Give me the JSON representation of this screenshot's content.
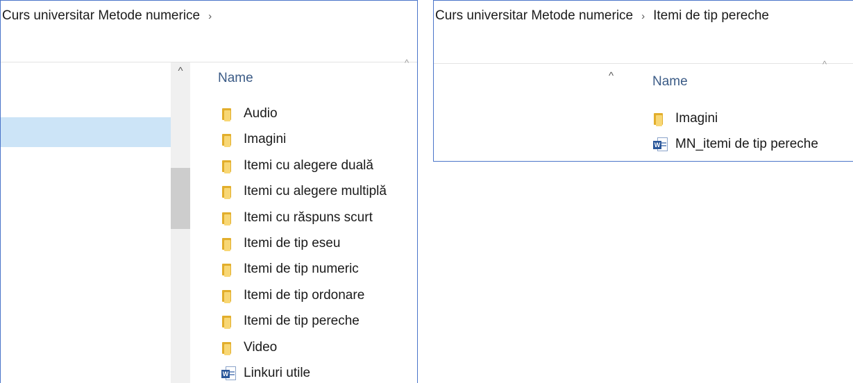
{
  "left_window": {
    "breadcrumb": {
      "path": "Curs universitar Metode numerice",
      "chevron": "›"
    },
    "scroll_up_glyph": "^",
    "column_header": {
      "sort_indicator": "^",
      "name": "Name"
    },
    "items": [
      {
        "label": "Audio",
        "icon": "folder-icon"
      },
      {
        "label": "Imagini",
        "icon": "folder-icon"
      },
      {
        "label": "Itemi cu alegere duală",
        "icon": "folder-icon"
      },
      {
        "label": "Itemi cu alegere multiplă",
        "icon": "folder-icon"
      },
      {
        "label": "Itemi cu răspuns scurt",
        "icon": "folder-icon"
      },
      {
        "label": "Itemi de tip eseu",
        "icon": "folder-icon"
      },
      {
        "label": "Itemi de tip numeric",
        "icon": "folder-icon"
      },
      {
        "label": "Itemi de tip ordonare",
        "icon": "folder-icon"
      },
      {
        "label": "Itemi de tip pereche",
        "icon": "folder-icon"
      },
      {
        "label": "Video",
        "icon": "folder-icon"
      },
      {
        "label": "Linkuri utile",
        "icon": "word-document-icon"
      }
    ]
  },
  "right_window": {
    "breadcrumb": {
      "path": "Curs universitar Metode numerice",
      "chevron": "›",
      "current": "Itemi de tip pereche"
    },
    "scroll_up_glyph": "^",
    "column_header": {
      "sort_indicator": "^",
      "name": "Name"
    },
    "items": [
      {
        "label": "Imagini",
        "icon": "folder-icon"
      },
      {
        "label": "MN_itemi de tip pereche",
        "icon": "word-document-icon"
      }
    ]
  },
  "colors": {
    "window_border": "#4a74c9",
    "selection": "#cce4f7",
    "column_header_text": "#3b5b86",
    "folder": "#f8d775",
    "word": "#2b579a"
  },
  "icon_glyphs": {
    "word_badge": "W"
  }
}
